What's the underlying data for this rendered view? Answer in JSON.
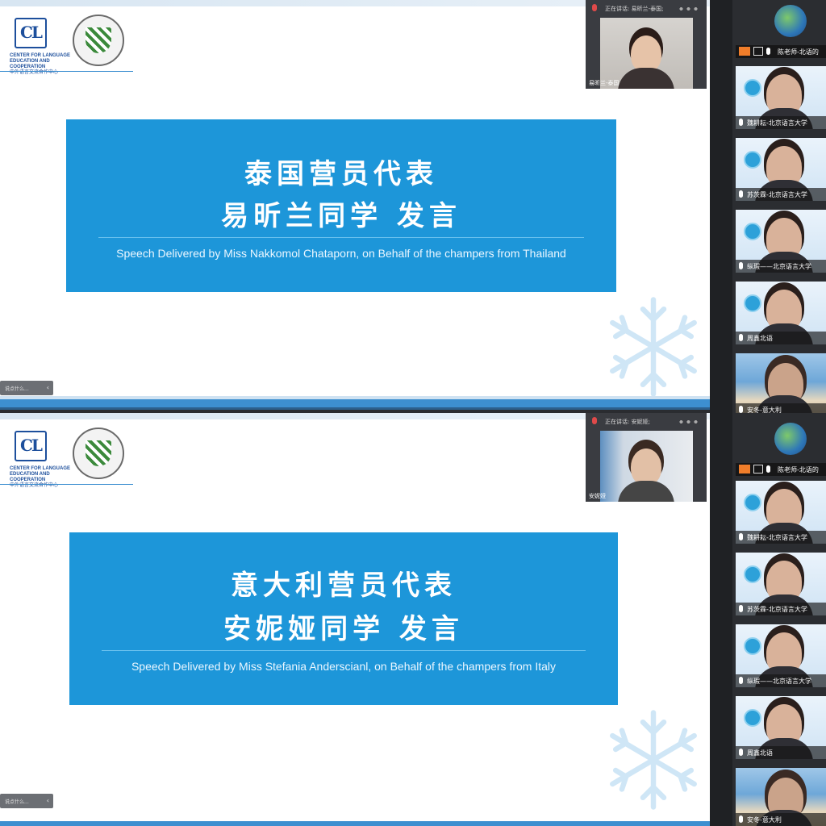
{
  "panels": [
    {
      "slide": {
        "logo_text_en": "CENTER FOR LANGUAGE\nEDUCATION AND COOPERATION",
        "logo_text_cn": "中外语言交流合作中心",
        "title_line1": "泰国营员代表",
        "title_line2": "易昕兰同学  发言",
        "subtitle_en": "Speech Delivered by Miss Nakkomol Chataporn,  on Behalf of the champers from Thailand"
      },
      "active_speaker": {
        "header": "正在讲话: 易昕兰-泰国;",
        "name": "易昕兰-泰国"
      },
      "float_button": "说点什么...",
      "participants": [
        {
          "label": "陈老师-北语的",
          "type": "globe"
        },
        {
          "label": "魏耕耘-北京语言大学",
          "type": "person"
        },
        {
          "label": "苏茨霖-北京语言大学",
          "type": "person"
        },
        {
          "label": "纵瑕——北京语言大学",
          "type": "person"
        },
        {
          "label": "周鑫北语",
          "type": "person"
        },
        {
          "label": "安冬-意大利",
          "type": "beach"
        }
      ]
    },
    {
      "slide": {
        "logo_text_en": "CENTER FOR LANGUAGE\nEDUCATION AND COOPERATION",
        "logo_text_cn": "中外语言交流合作中心",
        "title_line1": "意大利营员代表",
        "title_line2": "安妮娅同学  发言",
        "subtitle_en": "Speech Delivered by Miss Stefania Anderscianl,  on Behalf of the champers from Italy"
      },
      "active_speaker": {
        "header": "正在讲话: 安妮娅;",
        "name": "安妮娅"
      },
      "float_button": "说点什么...",
      "participants": [
        {
          "label": "陈老师-北语的",
          "type": "globe"
        },
        {
          "label": "魏耕耘-北京语言大学",
          "type": "person"
        },
        {
          "label": "苏茨霖-北京语言大学",
          "type": "person"
        },
        {
          "label": "纵瑕——北京语言大学",
          "type": "person"
        },
        {
          "label": "周鑫北语",
          "type": "person"
        },
        {
          "label": "安冬-意大利",
          "type": "beach"
        }
      ]
    }
  ],
  "colors": {
    "banner": "#1d96d9",
    "accent": "#3d8fd0",
    "host_badge": "#f07d2a"
  },
  "icons": {
    "snowflake": "snowflake-icon",
    "mic": "microphone-icon",
    "host": "host-icon",
    "screen": "screen-share-icon",
    "chevron": "chevron-left-icon"
  }
}
